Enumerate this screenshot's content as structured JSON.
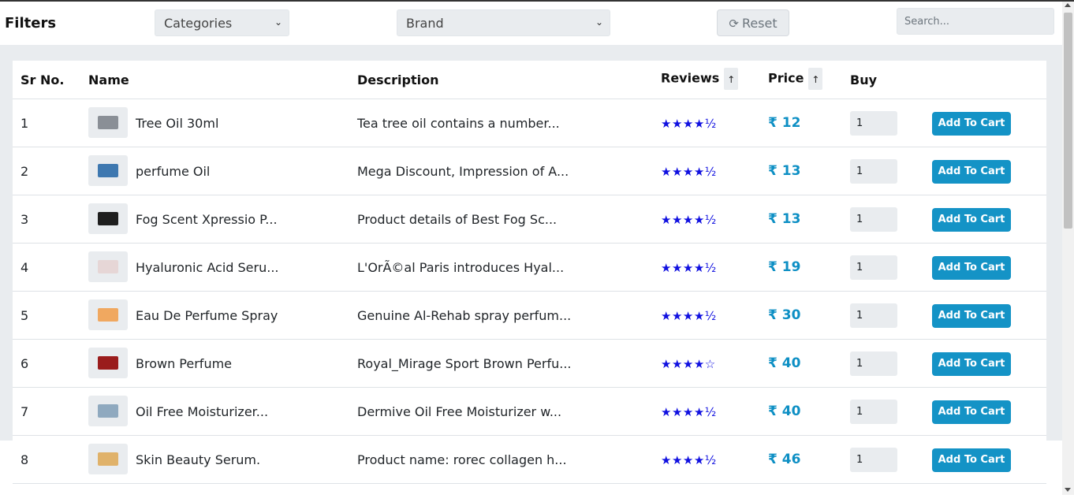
{
  "filters": {
    "title": "Filters",
    "categories_value": "Categories",
    "brand_value": "Brand",
    "reset_label": "Reset",
    "search_placeholder": "Search..."
  },
  "table": {
    "headers": {
      "sr": "Sr No.",
      "name": "Name",
      "description": "Description",
      "reviews": "Reviews",
      "price": "Price",
      "buy": "Buy",
      "sort_indicator": "↑"
    },
    "add_to_cart_label": "Add To Cart",
    "rows": [
      {
        "sr": "1",
        "name": "Tree Oil 30ml",
        "description": "Tea tree oil contains a number...",
        "stars": "★★★★½",
        "price": "₹ 12",
        "qty": "1",
        "thumb_color": "#8a8f96"
      },
      {
        "sr": "2",
        "name": "perfume Oil",
        "description": "Mega Discount, Impression of A...",
        "stars": "★★★★½",
        "price": "₹ 13",
        "qty": "1",
        "thumb_color": "#3e78b0"
      },
      {
        "sr": "3",
        "name": "Fog Scent Xpressio P...",
        "description": "Product details of Best Fog Sc...",
        "stars": "★★★★½",
        "price": "₹ 13",
        "qty": "1",
        "thumb_color": "#1e1e1e"
      },
      {
        "sr": "4",
        "name": "Hyaluronic Acid Seru...",
        "description": "L'OrÃ©al Paris introduces Hyal...",
        "stars": "★★★★½",
        "price": "₹ 19",
        "qty": "1",
        "thumb_color": "#e6d6d6"
      },
      {
        "sr": "5",
        "name": "Eau De Perfume Spray",
        "description": "Genuine Al-Rehab spray perfum...",
        "stars": "★★★★½",
        "price": "₹ 30",
        "qty": "1",
        "thumb_color": "#f0a860"
      },
      {
        "sr": "6",
        "name": "Brown Perfume",
        "description": "Royal_Mirage Sport Brown Perfu...",
        "stars": "★★★★☆",
        "price": "₹ 40",
        "qty": "1",
        "thumb_color": "#9a1c1c"
      },
      {
        "sr": "7",
        "name": "Oil Free Moisturizer...",
        "description": "Dermive Oil Free Moisturizer w...",
        "stars": "★★★★½",
        "price": "₹ 40",
        "qty": "1",
        "thumb_color": "#8fa9bf"
      },
      {
        "sr": "8",
        "name": "Skin Beauty Serum.",
        "description": "Product name: rorec collagen h...",
        "stars": "★★★★½",
        "price": "₹ 46",
        "qty": "1",
        "thumb_color": "#e0b26a"
      }
    ]
  },
  "colors": {
    "accent": "#1493c6",
    "price": "#0d8fc4",
    "stars": "#1010e0"
  }
}
